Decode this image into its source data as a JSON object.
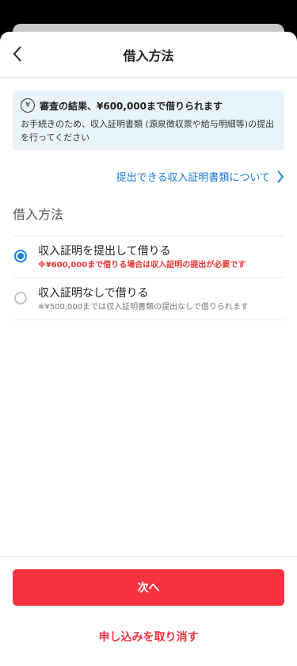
{
  "header": {
    "title": "借入方法"
  },
  "info": {
    "icon": "yen-circle-icon",
    "title": "審査の結果、¥600,000まで借りられます",
    "body": "お手続きのため、収入証明書類 (源泉徴収票や給与明細等)の提出を行ってください"
  },
  "link": {
    "label": "提出できる収入証明書類について"
  },
  "section": {
    "title": "借入方法"
  },
  "options": [
    {
      "label": "収入証明を提出して借りる",
      "note": "※¥600,000まで借りる場合は収入証明の提出が必要です",
      "selected": true
    },
    {
      "label": "収入証明なしで借りる",
      "note": "※¥500,000までは収入証明書類の提出なしで借りられます",
      "selected": false
    }
  ],
  "footer": {
    "next_label": "次へ",
    "cancel_label": "申し込みを取り消す"
  },
  "colors": {
    "accent": "#f5323f",
    "link": "#1976d2",
    "radio": "#1a7fe0",
    "info_bg": "#e8f4fb"
  }
}
